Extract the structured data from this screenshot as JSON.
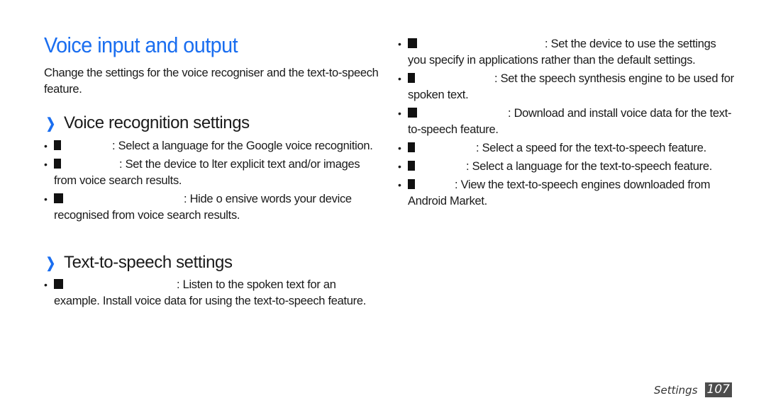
{
  "page": {
    "title": "Voice input and output",
    "intro": "Change the settings for the voice recogniser and the text-to-speech feature."
  },
  "sections": {
    "voice_recognition": {
      "heading": "Voice recognition settings",
      "items": [
        {
          "text": ": Select a language for the Google voice recognition."
        },
        {
          "text": ": Set the device to  lter explicit text and/or images from voice search results."
        },
        {
          "text": ": Hide o ensive words your device recognised from voice search results."
        }
      ]
    },
    "tts_left": {
      "heading": "Text-to-speech settings",
      "items": [
        {
          "text": ": Listen to the spoken text for an example. Install voice data for using the text-to-speech feature."
        }
      ]
    },
    "tts_right": {
      "items": [
        {
          "text": ": Set the device to use the settings you specify in applications rather than the default settings."
        },
        {
          "text": ": Set the speech synthesis engine to be used for spoken text."
        },
        {
          "text": ": Download and install voice data for the text-to-speech feature."
        },
        {
          "text": ": Select a speed for the text-to-speech feature."
        },
        {
          "text": ": Select a language for the text-to-speech feature."
        },
        {
          "text": ": View the text-to-speech engines downloaded from Android Market."
        }
      ]
    }
  },
  "footer": {
    "section_label": "Settings",
    "page_number": "107"
  },
  "colors": {
    "accent": "#1a6ef0",
    "page_badge": "#4d4d4d"
  },
  "icons": {
    "chevron": "chevron-right-icon",
    "missing_glyph": "missing-glyph-box"
  }
}
